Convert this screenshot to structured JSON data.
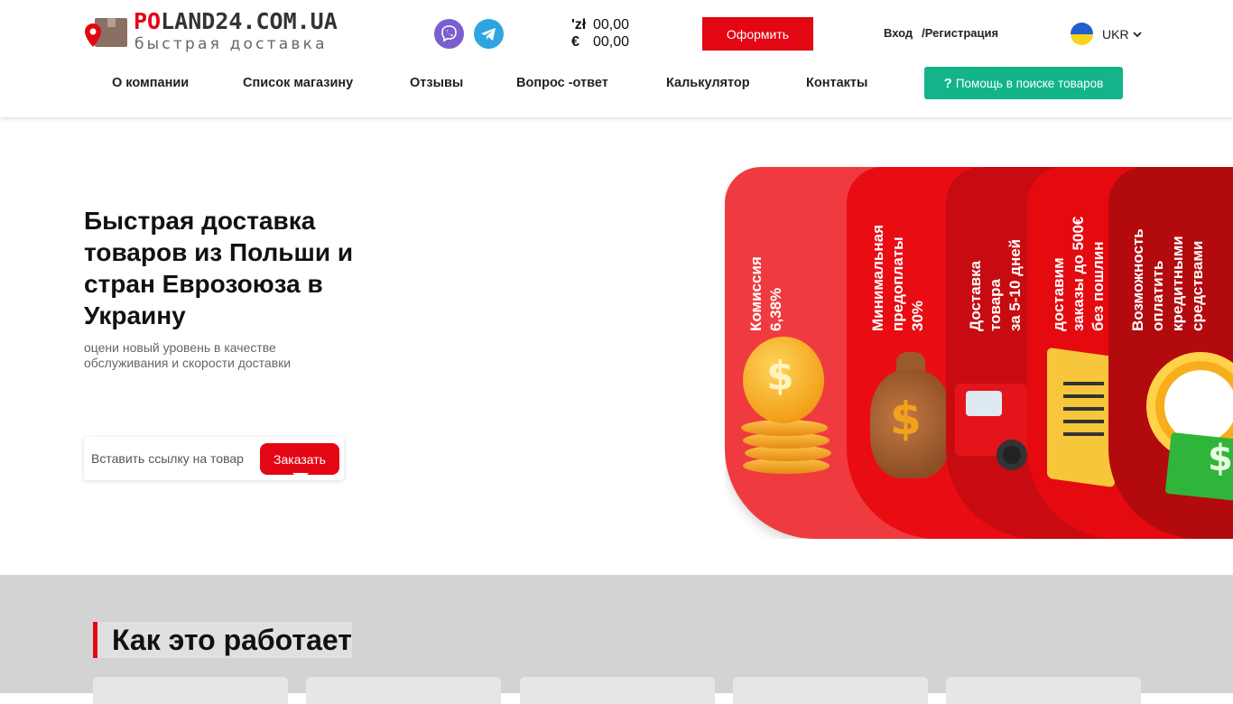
{
  "logo": {
    "title_accent": "PO",
    "title_rest": "LAND24.COM.UA",
    "subtitle": "быстрая доставка"
  },
  "social": {
    "viber_icon": "viber-icon",
    "telegram_icon": "telegram-icon"
  },
  "rates": [
    {
      "symbol": "'zł",
      "value": "00,00"
    },
    {
      "symbol": "€",
      "value": "00,00"
    }
  ],
  "header": {
    "order_label": "Оформить",
    "login_label": "Вход",
    "register_label": "/Регистрация",
    "language": "UKR"
  },
  "nav": {
    "items": [
      "О компании",
      "Список магазину",
      "Отзывы",
      "Вопрос -ответ",
      "Калькулятор",
      "Контакты"
    ],
    "help_label": "Помощь в поиске товаров",
    "help_icon": "?"
  },
  "hero": {
    "title": "Быстрая доставка товаров из Польши и стран Еврозоюза в Украину",
    "subtitle": "оцени новый уровень в качестве обслуживания и скорости доставки",
    "input_placeholder": "Вставить ссылку на товар",
    "order_button": "Заказать"
  },
  "cards": [
    {
      "label_line1": "Комиссия",
      "label_line2": "6,38%",
      "label_line3": ""
    },
    {
      "label_line1": "Минимальная",
      "label_line2": "предоплаты",
      "label_line3": "30%"
    },
    {
      "label_line1": "Доставка",
      "label_line2": "товара",
      "label_line3": "за 5-10 дней"
    },
    {
      "label_line1": "доставим",
      "label_line2": "заказы до 500€",
      "label_line3": "без пошлин"
    },
    {
      "label_line1": "Возможность",
      "label_line2": "оплатить",
      "label_line3": "кредитными",
      "label_line4": "средствами"
    }
  ],
  "how": {
    "title": "Как это работает"
  },
  "colors": {
    "brand_red": "#e30613",
    "help_green": "#13b48a"
  }
}
